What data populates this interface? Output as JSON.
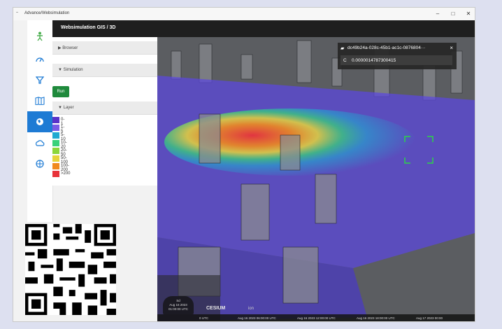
{
  "window": {
    "title": "Advance/Websimulation",
    "icon": "app-icon",
    "controls": [
      "–",
      "□",
      "✕"
    ]
  },
  "header": {
    "title": "Websimulation GIS / 3D"
  },
  "rail": {
    "items": [
      "person-icon",
      "speedometer-icon",
      "filter-icon",
      "map-icon",
      "globe-icon",
      "cloud-icon",
      "layers-icon"
    ],
    "active_index": 4
  },
  "panel": {
    "browser_label": "▶ Browser",
    "simulation_label": "▼ Simulation",
    "run_label": "Run",
    "layer_label": "▼ Layer",
    "legend": [
      {
        "label": "0-1",
        "color": "#5a33c9"
      },
      {
        "label": "1-5",
        "color": "#7a5be6"
      },
      {
        "label": "5-10",
        "color": "#1faad1"
      },
      {
        "label": "10-20",
        "color": "#38d17a"
      },
      {
        "label": "20-50",
        "color": "#8bd63b"
      },
      {
        "label": "50-100",
        "color": "#e6d43a"
      },
      {
        "label": "100-200",
        "color": "#f08a1e"
      },
      {
        "label": ">200",
        "color": "#e8333a"
      }
    ]
  },
  "info_box": {
    "id": "dc49b24a-028c-45b1-ac1c-0876804···",
    "label": "C",
    "value": "0.0000014787300415",
    "close": "×"
  },
  "clock": {
    "line1": "Sd",
    "line2": "Aug 16 2023",
    "line3": "01:00:00 UTC"
  },
  "timeline_labels": [
    "0 UTC",
    "Aug 16 2023 06:00:00 UTC",
    "Aug 16 2023 12:00:00 UTC",
    "Aug 16 2023 18:00:00 UTC",
    "Aug 17 2023 00:00"
  ],
  "credits": {
    "logo": "CESIUM",
    "ion": "ion"
  }
}
